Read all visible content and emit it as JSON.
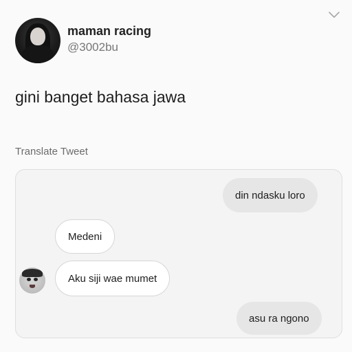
{
  "tweet": {
    "author": {
      "display_name": "maman racing",
      "handle": "@3002bu",
      "avatar_icon": "profile-photo"
    },
    "menu_icon": "chevron-down-icon",
    "text": "gini banget bahasa jawa",
    "translate_label": "Translate Tweet"
  },
  "chat": {
    "messages": [
      {
        "side": "outgoing",
        "text": "din ndasku loro"
      },
      {
        "side": "incoming",
        "text": "Medeni"
      },
      {
        "side": "incoming",
        "text": "Aku siji wae mumet"
      },
      {
        "side": "outgoing",
        "text": "asu ra ngono"
      }
    ],
    "colors": {
      "outgoing_bubble": "#e6e6e6",
      "incoming_bubble": "#ffffff"
    }
  }
}
